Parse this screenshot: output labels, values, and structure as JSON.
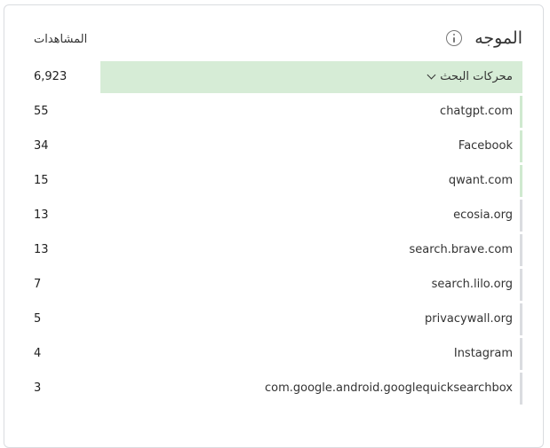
{
  "header": {
    "title": "الموجه",
    "info_icon": "info-icon",
    "column_label": "المشاهدات"
  },
  "group": {
    "label": "محركات البحث",
    "value": "6,923",
    "icon": "chevron-down-icon"
  },
  "rows": [
    {
      "label": "chatgpt.com",
      "value": "55"
    },
    {
      "label": "Facebook",
      "value": "34"
    },
    {
      "label": "qwant.com",
      "value": "15"
    },
    {
      "label": "ecosia.org",
      "value": "13"
    },
    {
      "label": "search.brave.com",
      "value": "13"
    },
    {
      "label": "search.lilo.org",
      "value": "7"
    },
    {
      "label": "privacywall.org",
      "value": "5"
    },
    {
      "label": "Instagram",
      "value": "4"
    },
    {
      "label": "com.google.android.googlequicksearchbox",
      "value": "3"
    }
  ],
  "colors": {
    "group_highlight": "#d6ecd6",
    "bar_accent": "#cfe9cf",
    "border": "#dadce0"
  }
}
